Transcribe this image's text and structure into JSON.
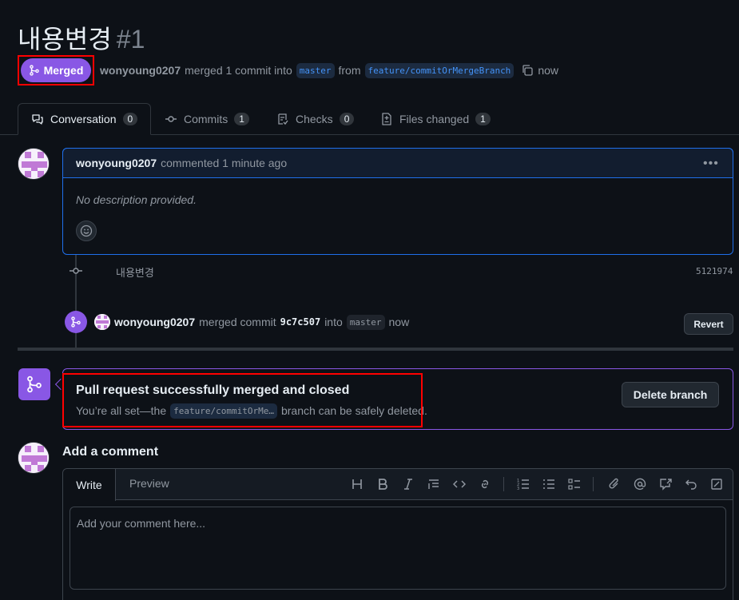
{
  "pr": {
    "title": "내용변경",
    "number": "#1",
    "state": "Merged",
    "author": "wonyoung0207",
    "merged_text": "merged 1 commit into",
    "base_branch": "master",
    "from_text": "from",
    "head_branch": "feature/commitOrMergeBranch",
    "time": "now"
  },
  "tabs": [
    {
      "label": "Conversation",
      "count": "0"
    },
    {
      "label": "Commits",
      "count": "1"
    },
    {
      "label": "Checks",
      "count": "0"
    },
    {
      "label": "Files changed",
      "count": "1"
    }
  ],
  "comment": {
    "author": "wonyoung0207",
    "action": "commented 1 minute ago",
    "body": "No description provided."
  },
  "commit": {
    "message": "내용변경",
    "sha": "5121974"
  },
  "merge_event": {
    "author": "wonyoung0207",
    "text1": "merged commit",
    "sha": "9c7c507",
    "text2": "into",
    "branch": "master",
    "time": "now",
    "revert_label": "Revert"
  },
  "merge_status": {
    "title": "Pull request successfully merged and closed",
    "sub_prefix": "You’re all set—the",
    "branch": "feature/commitOrMe…",
    "sub_suffix": "branch can be safely deleted.",
    "delete_label": "Delete branch"
  },
  "add_comment": {
    "heading": "Add a comment",
    "write_tab": "Write",
    "preview_tab": "Preview",
    "placeholder": "Add your comment here..."
  },
  "colors": {
    "merged_purple": "#8957e5",
    "accent_blue": "#1f6feb",
    "highlight_red": "#ff0000"
  }
}
